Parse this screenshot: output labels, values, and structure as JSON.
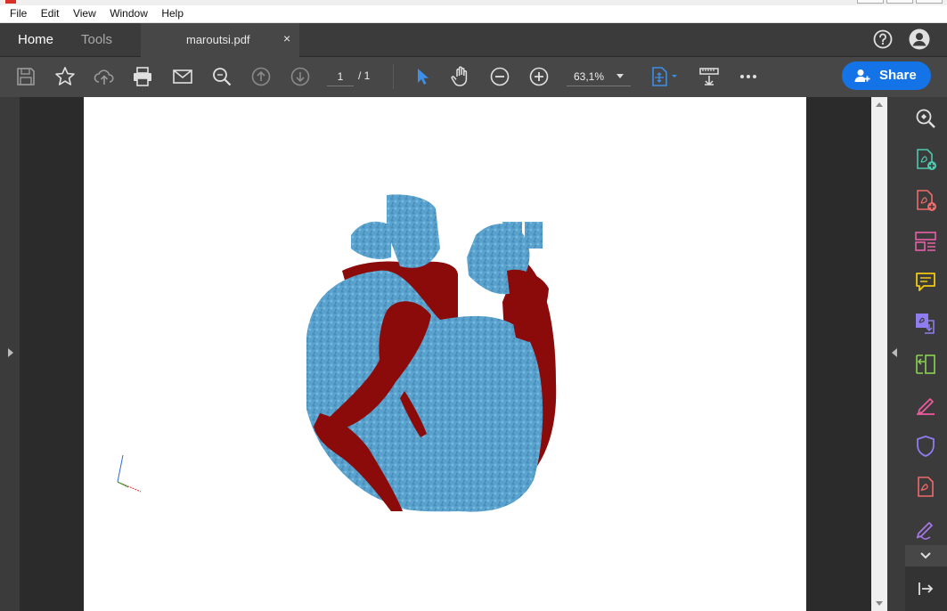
{
  "menu": [
    "File",
    "Edit",
    "View",
    "Window",
    "Help"
  ],
  "tabs": {
    "home_label": "Home",
    "tools_label": "Tools",
    "document_name": "maroutsi.pdf",
    "close_symbol": "×"
  },
  "toolbar": {
    "current_page": "1",
    "total_pages": "/ 1",
    "zoom": "63,1%",
    "share_label": "Share"
  },
  "colors": {
    "accent": "#1473e6",
    "heart_blue": "#5ba3cf",
    "heart_red": "#8b0a0a"
  }
}
